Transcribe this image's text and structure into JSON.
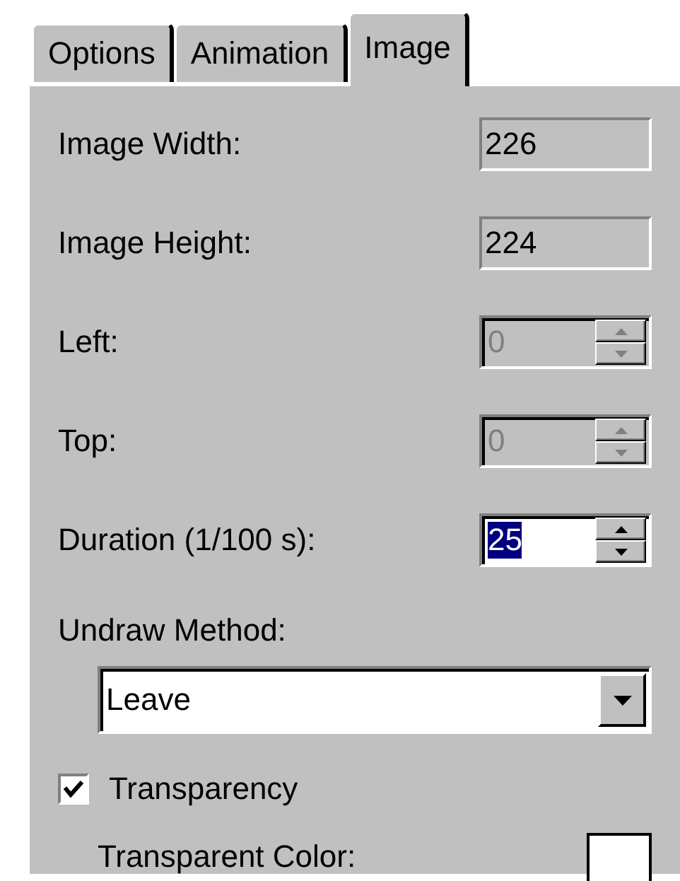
{
  "tabs": [
    {
      "label": "Options",
      "selected": false
    },
    {
      "label": "Animation",
      "selected": false
    },
    {
      "label": "Image",
      "selected": true
    }
  ],
  "fields": [
    {
      "kind": "readonly",
      "label": "Image Width:",
      "value": "226",
      "disabled": false,
      "highlighted": false
    },
    {
      "kind": "readonly",
      "label": "Image Height:",
      "value": "224",
      "disabled": false,
      "highlighted": false
    },
    {
      "kind": "spin",
      "label": "Left:",
      "value": "0",
      "disabled": true,
      "highlighted": false
    },
    {
      "kind": "spin",
      "label": "Top:",
      "value": "0",
      "disabled": true,
      "highlighted": false
    },
    {
      "kind": "spin",
      "label": "Duration (1/100 s):",
      "value": "25",
      "disabled": false,
      "highlighted": true
    }
  ],
  "undraw": {
    "label": "Undraw Method:",
    "value": "Leave"
  },
  "transparency": {
    "label": "Transparency",
    "checked": true
  },
  "transparent_color": {
    "label": "Transparent Color:",
    "color": "#ffffff"
  }
}
